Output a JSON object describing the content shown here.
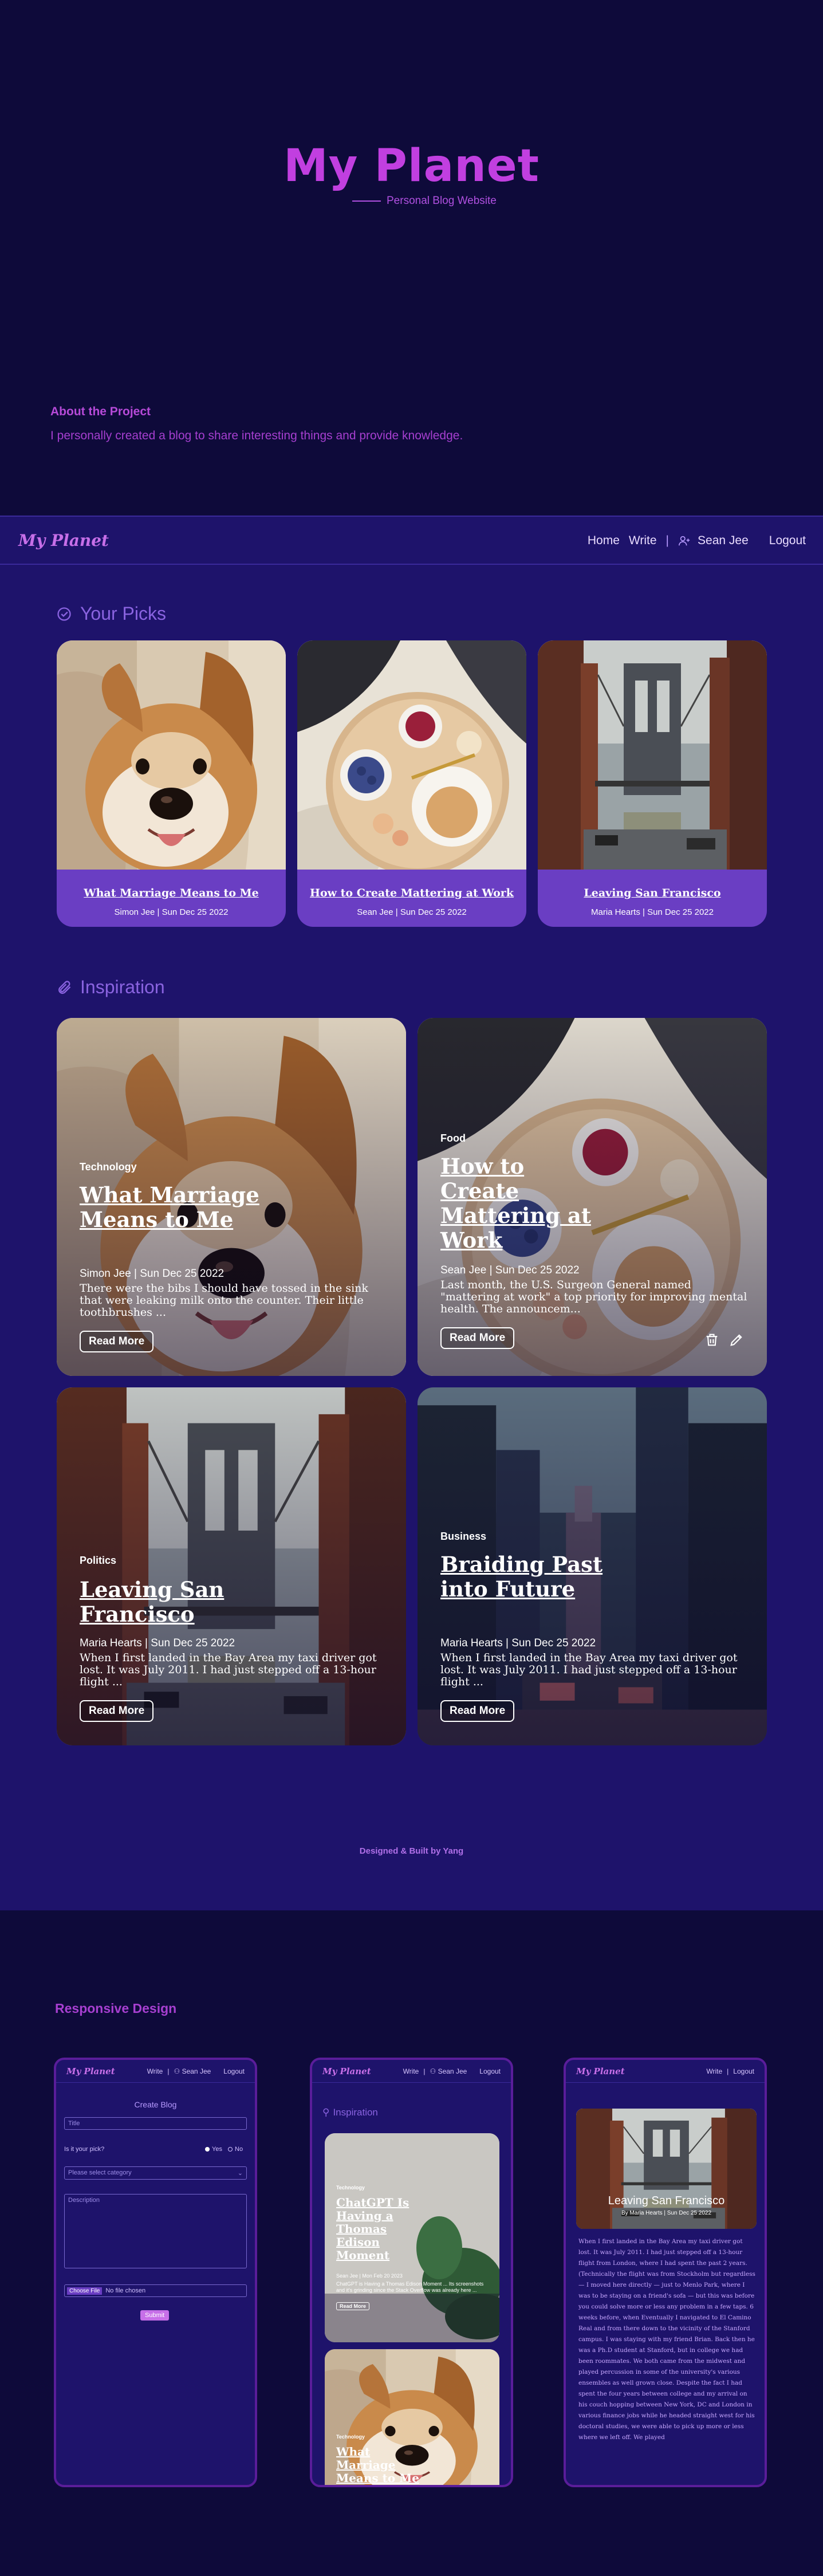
{
  "hero": {
    "title": "My Planet",
    "subtitle": "Personal Blog Website",
    "about_title": "About the Project",
    "about_text": "I personally created a blog to share interesting things and provide knowledge."
  },
  "nav": {
    "logo": "My Planet",
    "home": "Home",
    "write": "Write",
    "separator": "|",
    "user": "Sean Jee",
    "logout": "Logout"
  },
  "picks": {
    "heading": "Your Picks",
    "items": [
      {
        "title": "What Marriage Means to Me",
        "meta": "Simon Jee | Sun Dec 25 2022",
        "image": "dog"
      },
      {
        "title": "How to Create Mattering at Work",
        "meta": "Sean Jee | Sun Dec 25 2022",
        "image": "breakfast"
      },
      {
        "title": "Leaving San Francisco",
        "meta": "Maria Hearts | Sun Dec 25 2022",
        "image": "bridge"
      }
    ]
  },
  "inspiration": {
    "heading": "Inspiration",
    "read_more": "Read More",
    "posts": [
      {
        "category": "Technology",
        "title": "What Marriage Means to Me",
        "meta": "Simon Jee | Sun Dec 25 2022",
        "excerpt": "There were the bibs I should have tossed in the sink that were leaking milk onto the counter. Their little toothbrushes ...",
        "image": "dog"
      },
      {
        "category": "Food",
        "title": "How to Create Mattering at Work",
        "meta": "Sean Jee | Sun Dec 25 2022",
        "excerpt": "Last month, the U.S. Surgeon General named \"mattering at work\" a top priority for improving mental health. The announcem...",
        "image": "breakfast",
        "actions": [
          "trash-icon",
          "pencil-icon"
        ]
      },
      {
        "category": "Politics",
        "title": "Leaving San Francisco",
        "meta": "Maria Hearts | Sun Dec 25 2022",
        "excerpt": "When I first landed in the Bay Area my taxi driver got lost. It was July 2011. I had just stepped off a 13-hour flight ...",
        "image": "bridge"
      },
      {
        "category": "Business",
        "title": "Braiding Past into Future",
        "meta": "Maria Hearts | Sun Dec 25 2022",
        "excerpt": "When I first landed in the Bay Area my taxi driver got lost. It was July 2011. I had just stepped off a 13-hour flight ...",
        "image": "city"
      }
    ]
  },
  "footer": {
    "credit": "Designed & Built by Yang"
  },
  "responsive": {
    "title": "Responsive Design",
    "phone1": {
      "logo": "My Planet",
      "write": "Write",
      "separator": "|",
      "user": "Sean Jee",
      "logout": "Logout",
      "form_title": "Create Blog",
      "title_placeholder": "Title",
      "pick_label": "Is it your pick?",
      "yes": "Yes",
      "no": "No",
      "category_placeholder": "Please select category",
      "description_placeholder": "Description",
      "file_button": "Choose File",
      "file_status": "No file chosen",
      "submit": "Submit"
    },
    "phone2": {
      "logo": "My Planet",
      "write": "Write",
      "separator": "|",
      "user": "Sean Jee",
      "logout": "Logout",
      "heading": "Inspiration",
      "card1": {
        "category": "Technology",
        "title": "ChatGPT Is Having a Thomas Edison Moment",
        "meta": "Sean Jee | Mon Feb 20 2023",
        "excerpt": "ChatGPT is Having a Thomas Edison Moment ... Its screenshots and it's grinding since the Stack Overflow was already here ...",
        "read_more": "Read More"
      },
      "card2": {
        "category": "Technology",
        "title": "What Marriage Means to Me"
      }
    },
    "phone3": {
      "logo": "My Planet",
      "write": "Write",
      "separator": "|",
      "logout": "Logout",
      "title": "Leaving San Francisco",
      "meta": "By Maria Hearts | Sun Dec 25 2022",
      "body": "When I first landed in the Bay Area my taxi driver got lost. It was July 2011. I had just stepped off a 13-hour flight from London, where I had spent the past 2 years. (Technically the flight was from Stockholm but regardless — I moved here directly — just to Menlo Park, where I was to be staying on a friend's sofa — but this was before you could solve more or less any problem in a few taps. 6 weeks before, when Eventually I navigated to El Camino Real and from there down to the vicinity of the Stanford campus. I was staying with my friend Brian. Back then he was a Ph.D student at Stanford, but in college we had been roommates. We both came from the midwest and played percussion in some of the university's various ensembles as well grown close. Despite the fact I had spent the four years between college and my arrival on his couch hopping between New York, DC and London in various finance jobs while he headed straight west for his doctoral studies, we were able to pick up more or less where we left off. We played"
    }
  },
  "colors": {
    "background": "#0e0a3a",
    "main": "#1e136b",
    "accent": "#c13fe0",
    "card": "#6a3ec3"
  }
}
